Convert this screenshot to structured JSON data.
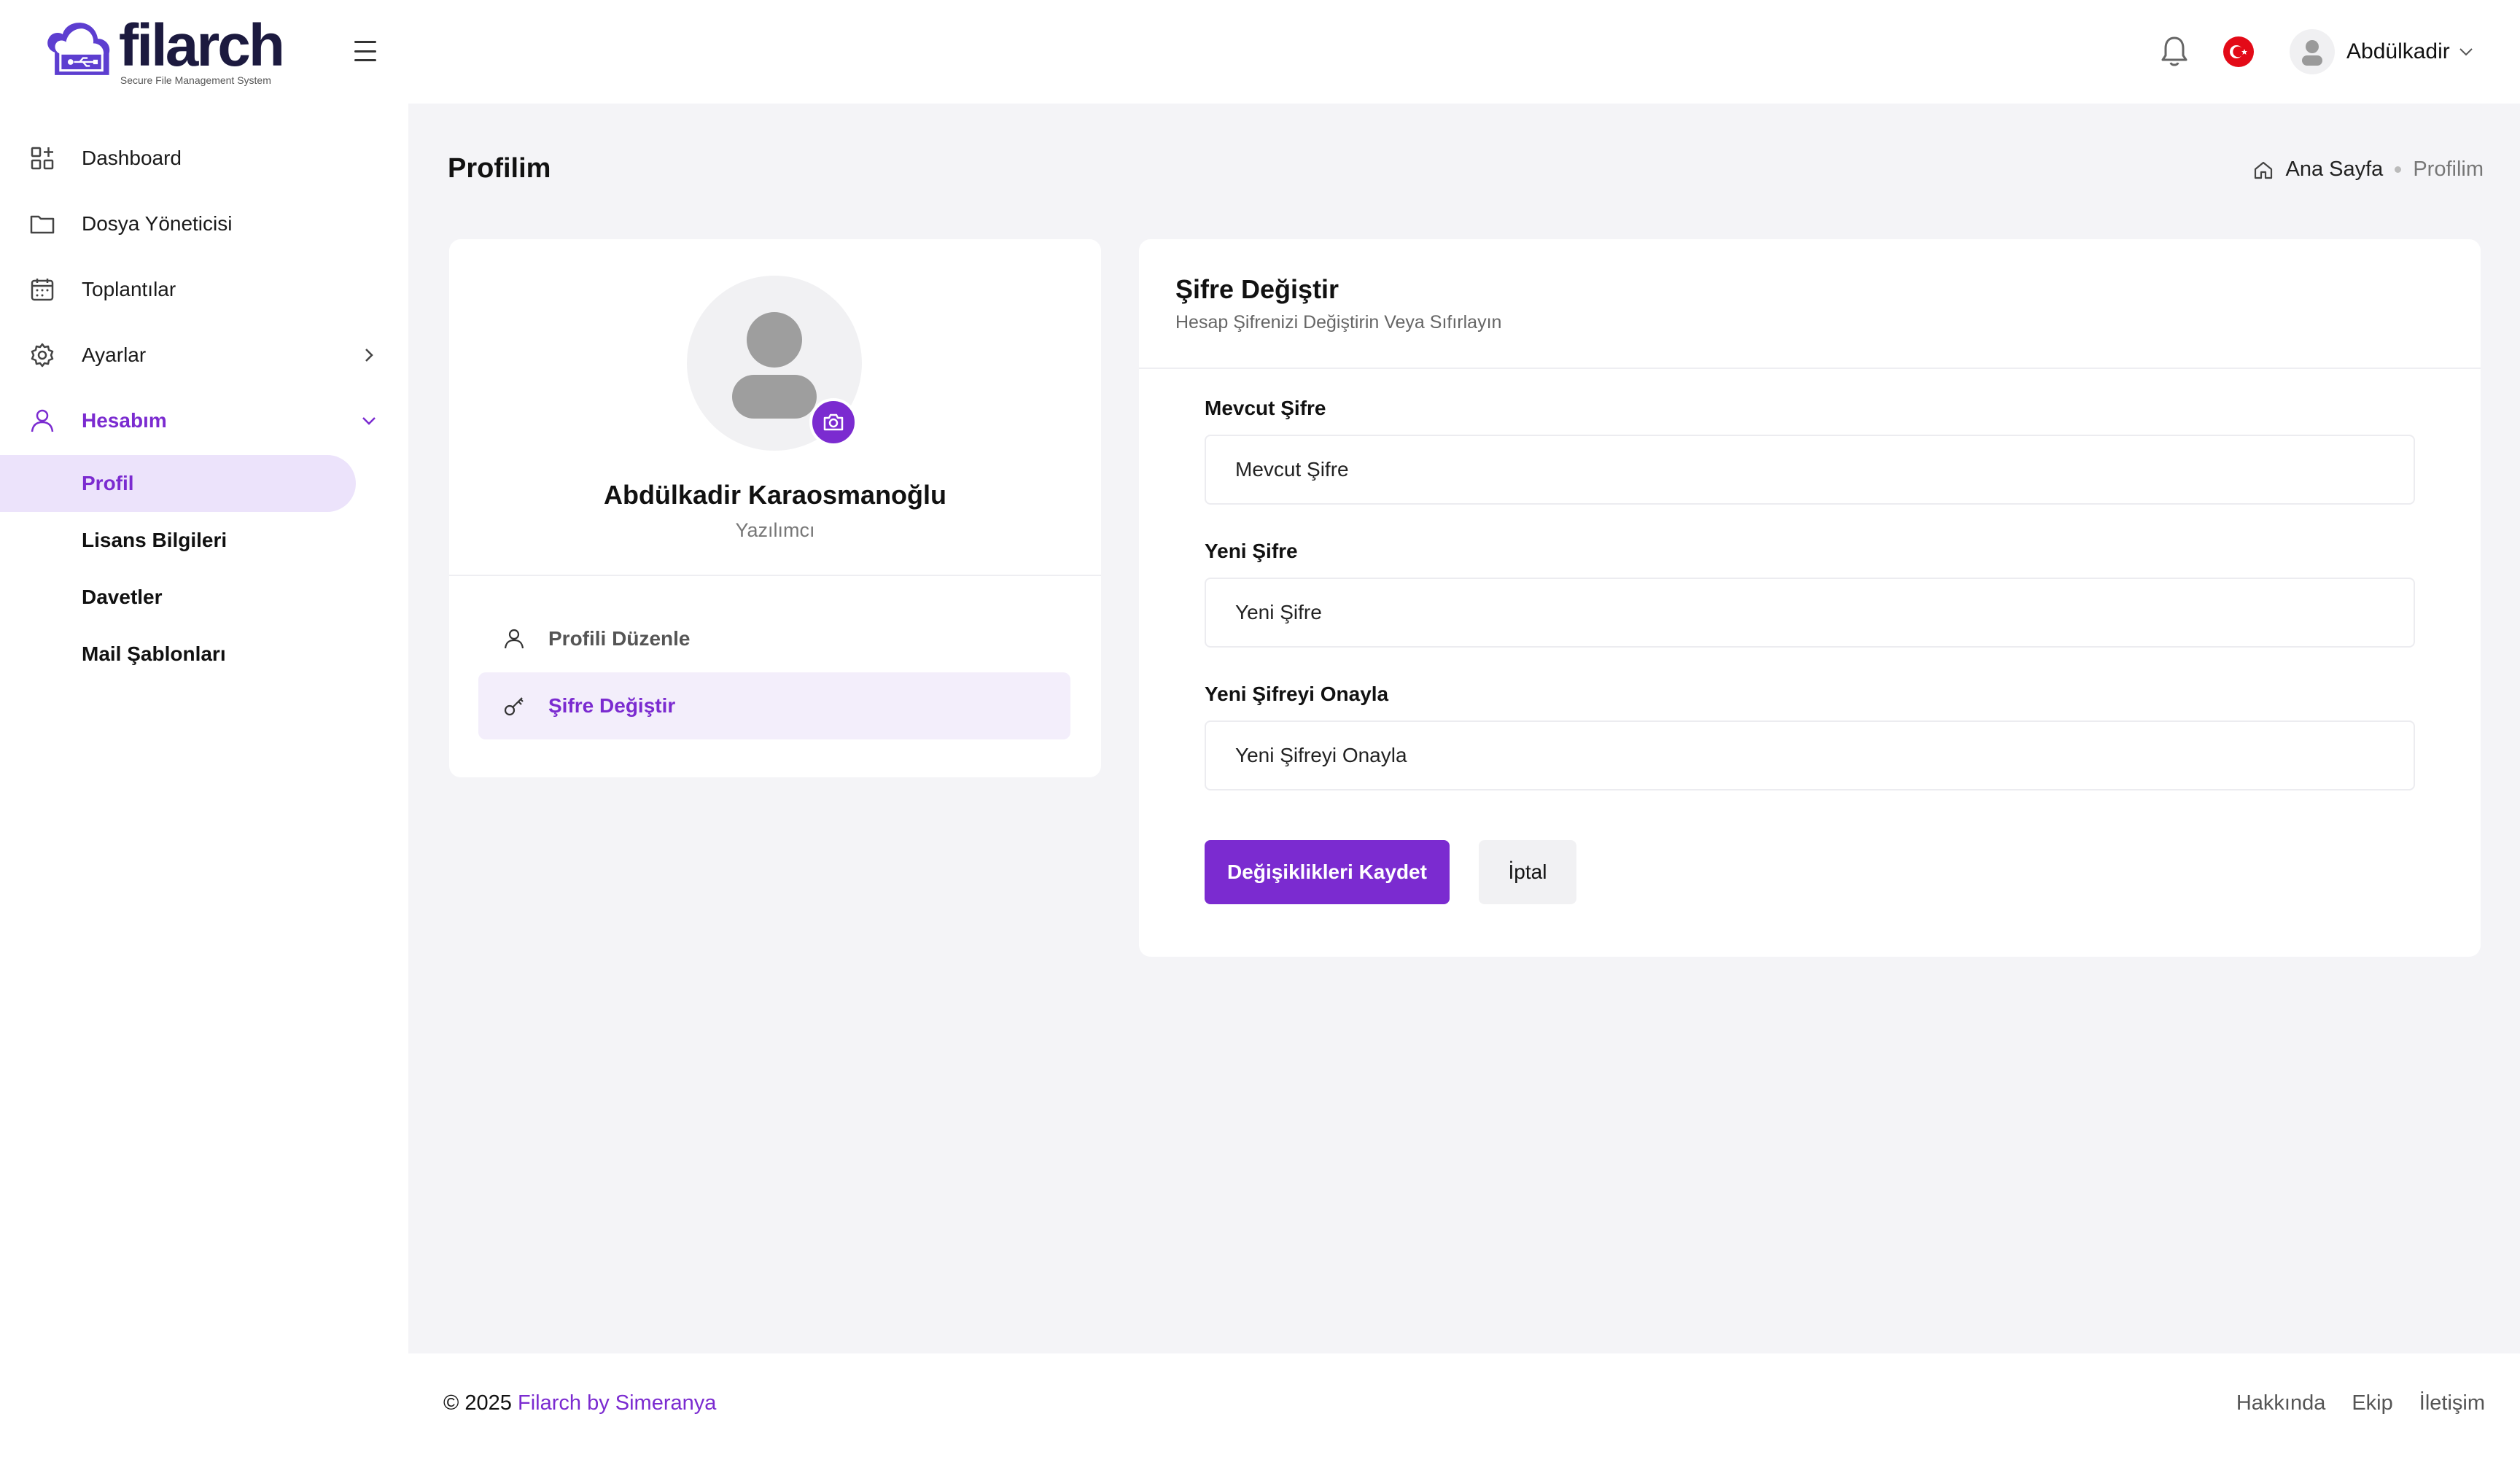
{
  "brand": {
    "name": "filarch",
    "tagline": "Secure File Management System",
    "accent_color": "#7b2bd0"
  },
  "header": {
    "notification_icon": "bell-icon",
    "language_flag": "turkey-flag-icon",
    "user_name": "Abdülkadir"
  },
  "sidebar": {
    "items": [
      {
        "label": "Dashboard",
        "icon": "dashboard-grid-icon"
      },
      {
        "label": "Dosya Yöneticisi",
        "icon": "folder-icon"
      },
      {
        "label": "Toplantılar",
        "icon": "calendar-icon"
      },
      {
        "label": "Ayarlar",
        "icon": "gear-icon"
      },
      {
        "label": "Hesabım",
        "icon": "user-icon"
      }
    ],
    "subitems": [
      {
        "label": "Profil"
      },
      {
        "label": "Lisans Bilgileri"
      },
      {
        "label": "Davetler"
      },
      {
        "label": "Mail Şablonları"
      }
    ]
  },
  "page": {
    "title": "Profilim",
    "breadcrumb": {
      "home": "Ana Sayfa",
      "current": "Profilim"
    }
  },
  "profile_card": {
    "name": "Abdülkadir Karaosmanoğlu",
    "role": "Yazılımcı",
    "nav": [
      {
        "label": "Profili Düzenle",
        "icon": "user-icon"
      },
      {
        "label": "Şifre Değiştir",
        "icon": "key-icon"
      }
    ]
  },
  "password_form": {
    "title": "Şifre Değiştir",
    "subtitle": "Hesap Şifrenizi Değiştirin Veya Sıfırlayın",
    "fields": [
      {
        "label": "Mevcut Şifre",
        "placeholder": "Mevcut Şifre"
      },
      {
        "label": "Yeni Şifre",
        "placeholder": "Yeni Şifre"
      },
      {
        "label": "Yeni Şifreyi Onayla",
        "placeholder": "Yeni Şifreyi Onayla"
      }
    ],
    "save_label": "Değişiklikleri Kaydet",
    "cancel_label": "İptal"
  },
  "footer": {
    "copyright_prefix": "© 2025 ",
    "copyright_link": "Filarch by Simeranya",
    "links": [
      "Hakkında",
      "Ekip",
      "İletişim"
    ]
  }
}
